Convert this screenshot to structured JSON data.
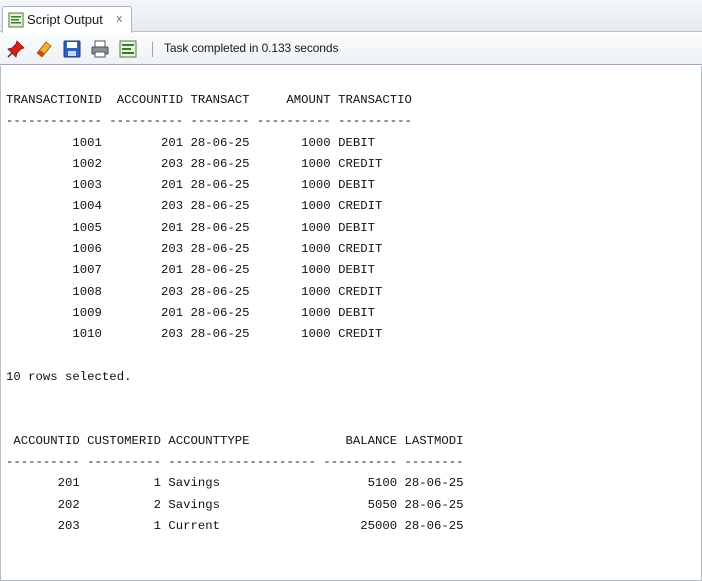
{
  "tab": {
    "title": "Script Output",
    "close_glyph": "x",
    "icon": "script-output-icon"
  },
  "toolbar": {
    "status_text": "Task completed in 0.133 seconds",
    "buttons": [
      "pin-icon",
      "eraser-icon",
      "save-icon",
      "print-icon",
      "export-icon"
    ]
  },
  "output": {
    "lines": [
      "TRANSACTIONID  ACCOUNTID TRANSACT     AMOUNT TRANSACTIO",
      "------------- ---------- -------- ---------- ----------",
      "         1001        201 28-06-25       1000 DEBIT",
      "         1002        203 28-06-25       1000 CREDIT",
      "         1003        201 28-06-25       1000 DEBIT",
      "         1004        203 28-06-25       1000 CREDIT",
      "         1005        201 28-06-25       1000 DEBIT",
      "         1006        203 28-06-25       1000 CREDIT",
      "         1007        201 28-06-25       1000 DEBIT",
      "         1008        203 28-06-25       1000 CREDIT",
      "         1009        201 28-06-25       1000 DEBIT",
      "         1010        203 28-06-25       1000 CREDIT",
      "",
      "10 rows selected.",
      "",
      "",
      " ACCOUNTID CUSTOMERID ACCOUNTTYPE             BALANCE LASTMODI",
      "---------- ---------- -------------------- ---------- --------",
      "       201          1 Savings                    5100 28-06-25",
      "       202          2 Savings                    5050 28-06-25",
      "       203          1 Current                   25000 28-06-25"
    ]
  }
}
